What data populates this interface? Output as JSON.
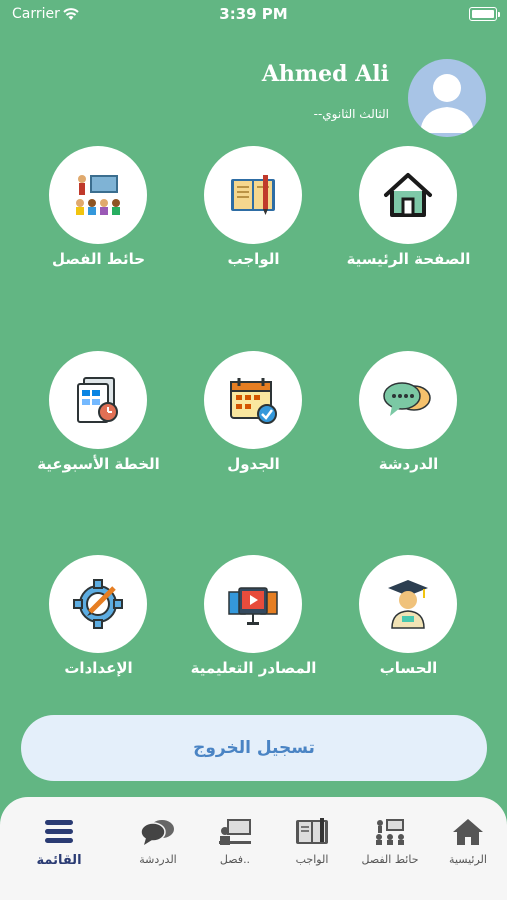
{
  "status_bar": {
    "carrier": "Carrier",
    "time": "3:39 PM"
  },
  "profile": {
    "name": "Ahmed Ali",
    "grade": "الثالث الثانوي--"
  },
  "grid": [
    {
      "label": "حائط الفصل",
      "icon": "classroom-icon"
    },
    {
      "label": "الواجب",
      "icon": "homework-book-icon"
    },
    {
      "label": "الصفحة الرئيسية",
      "icon": "home-icon"
    },
    {
      "label": "الخطة الأسبوعية",
      "icon": "weekly-plan-icon"
    },
    {
      "label": "الجدول",
      "icon": "calendar-icon"
    },
    {
      "label": "الدردشة",
      "icon": "chat-icon"
    },
    {
      "label": "الإعدادات",
      "icon": "settings-gear-icon"
    },
    {
      "label": "المصادر التعليمية",
      "icon": "learning-resources-icon"
    },
    {
      "label": "الحساب",
      "icon": "graduate-account-icon"
    }
  ],
  "logout_label": "تسجيل الخروج",
  "tabs": [
    {
      "label": "القائمة",
      "icon": "menu-icon",
      "active": true
    },
    {
      "label": "الدردشة",
      "icon": "chat-icon"
    },
    {
      "label": "فصل..",
      "icon": "virtual-class-icon"
    },
    {
      "label": "الواجب",
      "icon": "homework-icon"
    },
    {
      "label": "حائط الفصل",
      "icon": "classroom-icon"
    },
    {
      "label": "الرئيسية",
      "icon": "home-icon"
    }
  ],
  "colors": {
    "background": "#62b683",
    "logout_text": "#4a84c4",
    "active_tab": "#2a3b73"
  }
}
